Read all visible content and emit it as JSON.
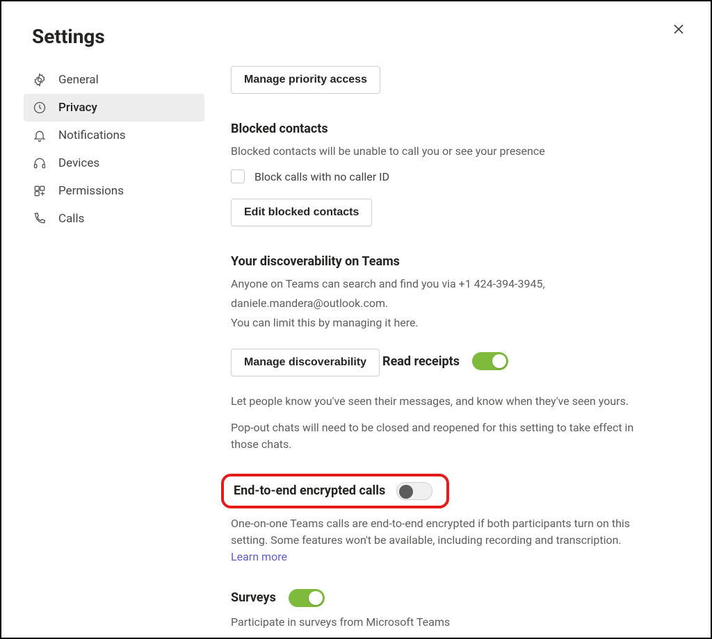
{
  "header": {
    "title": "Settings"
  },
  "sidebar": {
    "items": [
      {
        "label": "General",
        "icon": "gear-icon"
      },
      {
        "label": "Privacy",
        "icon": "clock-icon",
        "active": true
      },
      {
        "label": "Notifications",
        "icon": "bell-icon"
      },
      {
        "label": "Devices",
        "icon": "headset-icon"
      },
      {
        "label": "Permissions",
        "icon": "permissions-icon"
      },
      {
        "label": "Calls",
        "icon": "phone-icon"
      }
    ]
  },
  "buttons": {
    "manage_priority": "Manage priority access",
    "edit_blocked": "Edit blocked contacts",
    "manage_discover": "Manage discoverability"
  },
  "blocked": {
    "title": "Blocked contacts",
    "desc": "Blocked contacts will be unable to call you or see your presence",
    "chk_label": "Block calls with no caller ID"
  },
  "discover": {
    "title": "Your discoverability on Teams",
    "line1": "Anyone on Teams can search and find you via +1 424-394-3945,",
    "line2": "daniele.mandera@outlook.com.",
    "line3": "You can limit this by managing it here."
  },
  "read": {
    "title": "Read receipts",
    "p1": "Let people know you've seen their messages, and know when they've seen yours.",
    "p2": "Pop-out chats will need to be closed and reopened for this setting to take effect in those chats."
  },
  "e2e": {
    "title": "End-to-end encrypted calls",
    "desc": "One-on-one Teams calls are end-to-end encrypted if both participants turn on this setting. Some features won't be available, including recording and transcription. ",
    "learn": "Learn more"
  },
  "surveys": {
    "title": "Surveys",
    "desc": "Participate in surveys from Microsoft Teams"
  }
}
